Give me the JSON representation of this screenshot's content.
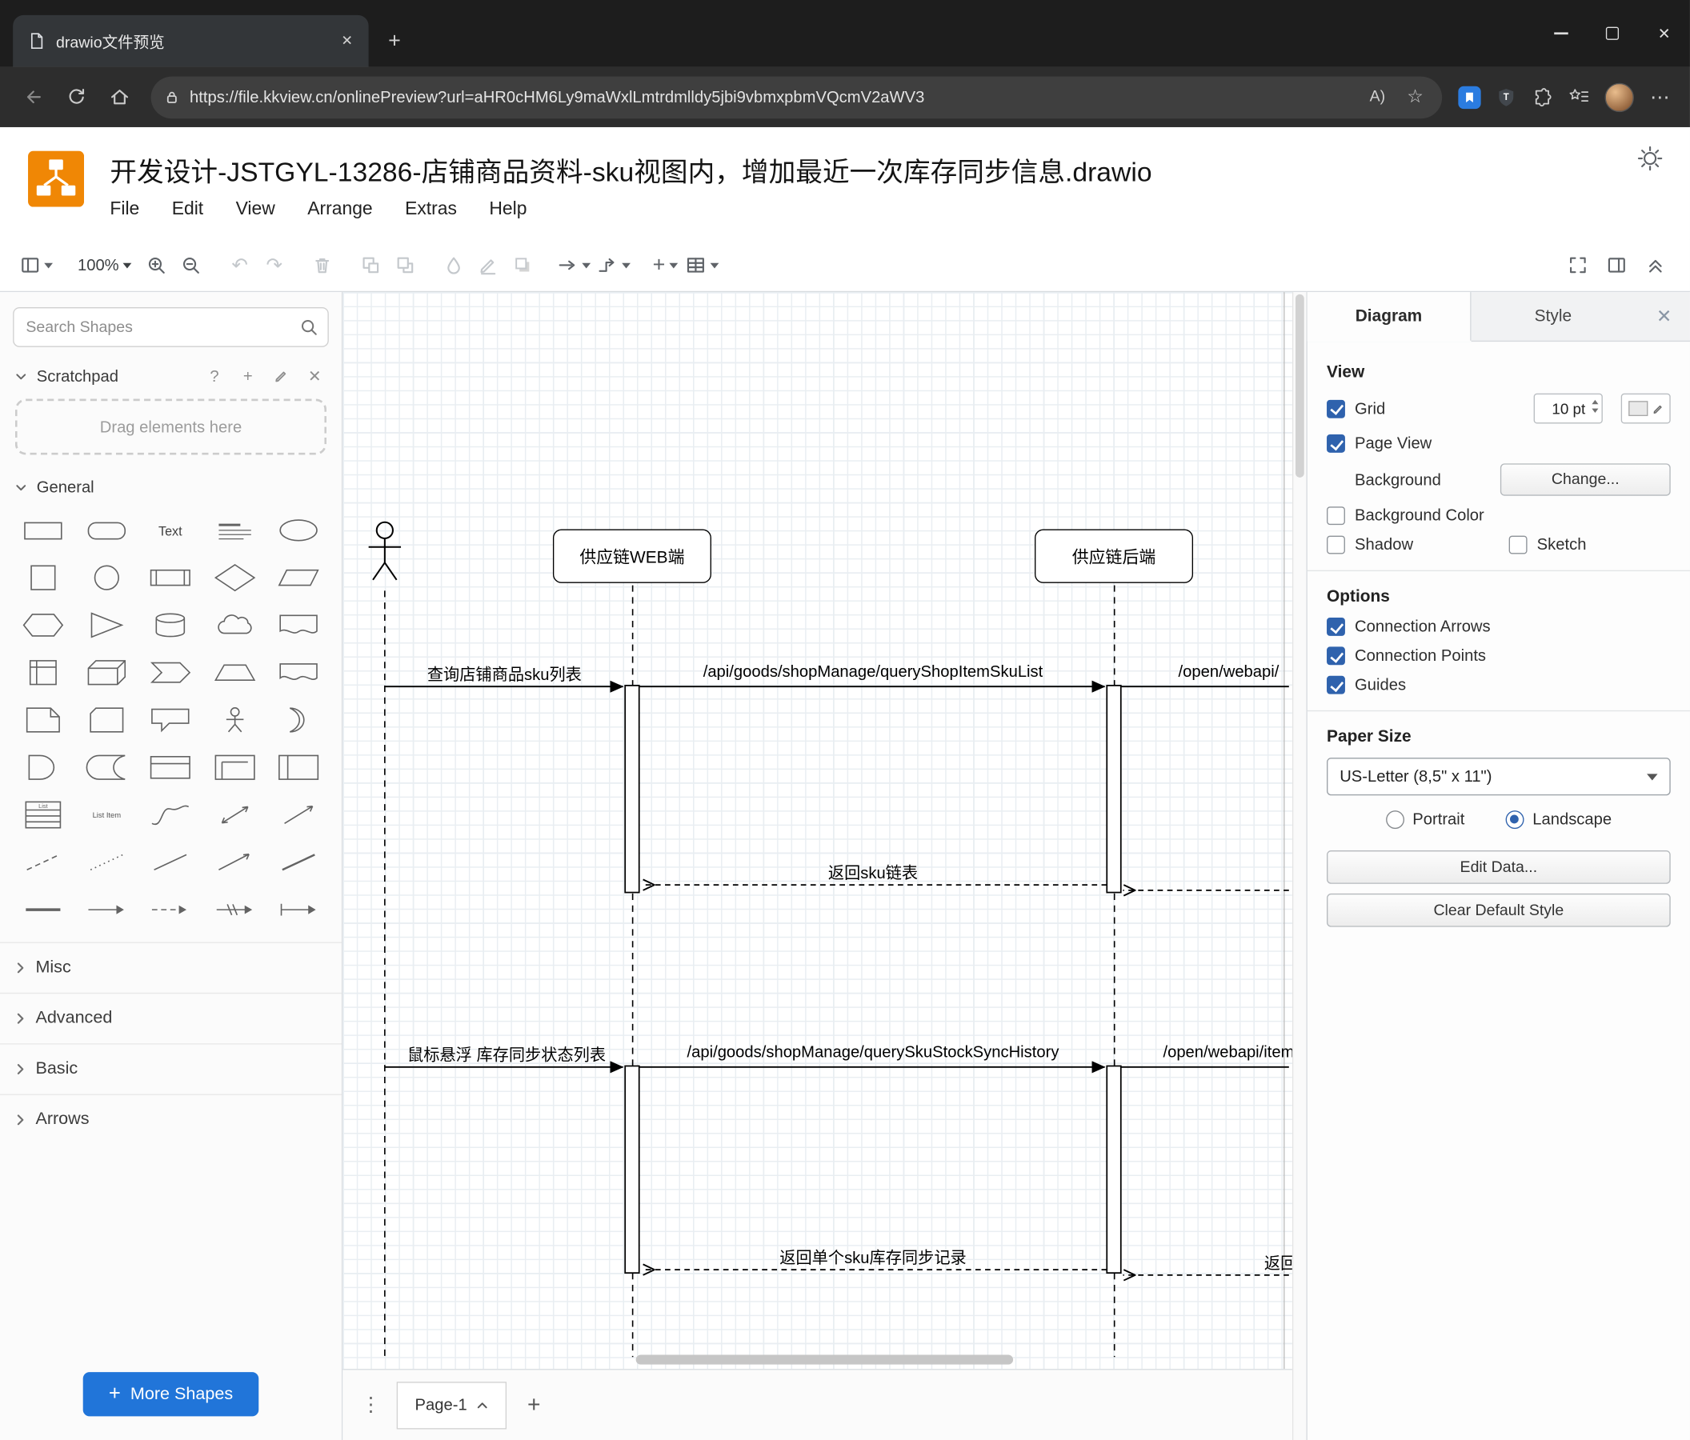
{
  "browser": {
    "tab_title": "drawio文件预览",
    "url": "https://file.kkview.cn/onlinePreview?url=aHR0cHM6Ly9maWxlLmtrdmlldy5jbi9vbmxpbmVQcmV2aWV3",
    "glyphs": {
      "close": "✕",
      "new_tab": "+",
      "read_aloud": "A)",
      "favorite": "☆",
      "more": "⋯"
    }
  },
  "header": {
    "title": "开发设计-JSTGYL-13286-店铺商品资料-sku视图内，增加最近一次库存同步信息.drawio",
    "menus": [
      "File",
      "Edit",
      "View",
      "Arrange",
      "Extras",
      "Help"
    ]
  },
  "toolbar": {
    "zoom": "100%",
    "insert_glyph": "+"
  },
  "sidebar": {
    "search_placeholder": "Search Shapes",
    "scratchpad_title": "Scratchpad",
    "drag_hint": "Drag elements here",
    "glyphs": {
      "help": "?",
      "add": "+",
      "close": "✕"
    },
    "sections": {
      "general": "General",
      "misc": "Misc",
      "advanced": "Advanced",
      "basic": "Basic",
      "arrows": "Arrows"
    },
    "shape_text_preview": "Text",
    "shape_list_label": "List",
    "shape_list_item_label": "List Item",
    "more_shapes": "More Shapes",
    "shape_names": [
      "rectangle",
      "rounded-rectangle",
      "text",
      "heading",
      "ellipse",
      "square",
      "circle",
      "process",
      "diamond",
      "parallelogram",
      "hexagon",
      "triangle",
      "cylinder",
      "cloud",
      "document",
      "internal-storage",
      "cube",
      "step",
      "trapezoid",
      "tape",
      "note",
      "card",
      "callout",
      "actor",
      "or",
      "and",
      "data-storage",
      "container",
      "frame",
      "vertical-container",
      "list",
      "list-item",
      "curve",
      "bidirectional-arrow",
      "diagonal-arrow",
      "dashed-line",
      "dotted-line",
      "line",
      "directional-arrow",
      "diagonal-line",
      "horizontal-line",
      "arrow",
      "dashed-arrow",
      "link",
      "arrow-with-tail"
    ]
  },
  "canvas": {
    "lifelines": {
      "web": "供应链WEB端",
      "backend": "供应链后端"
    },
    "messages": {
      "query_sku_list": "查询店铺商品sku列表",
      "api_query_shop_item_sku_list": "/api/goods/shopManage/queryShopItemSkuList",
      "open_webapi_right": "/open/webapi/",
      "return_sku_list": "返回sku链表",
      "hover_stock_sync_list": "鼠标悬浮 库存同步状态列表",
      "api_query_sku_stock_sync_history": "/api/goods/shopManage/querySkuStockSyncHistory",
      "open_webapi_item": "/open/webapi/item",
      "return_single_sku_record": "返回单个sku库存同步记录",
      "return_partial": "返回"
    }
  },
  "footer": {
    "page_tab": "Page-1",
    "kebab": "⋮",
    "add_page": "+"
  },
  "panel": {
    "tabs": {
      "diagram": "Diagram",
      "style": "Style",
      "close": "✕"
    },
    "view": {
      "heading": "View",
      "grid_label": "Grid",
      "grid_checked": true,
      "grid_value": "10 pt",
      "page_view_label": "Page View",
      "page_view_checked": true,
      "background_label": "Background",
      "change_button": "Change...",
      "background_color_label": "Background Color",
      "background_color_checked": false,
      "shadow_label": "Shadow",
      "shadow_checked": false,
      "sketch_label": "Sketch",
      "sketch_checked": false
    },
    "options": {
      "heading": "Options",
      "connection_arrows": "Connection Arrows",
      "connection_arrows_checked": true,
      "connection_points": "Connection Points",
      "connection_points_checked": true,
      "guides": "Guides",
      "guides_checked": true
    },
    "paper": {
      "heading": "Paper Size",
      "size_value": "US-Letter (8,5\" x 11\")",
      "portrait": "Portrait",
      "landscape": "Landscape",
      "orientation": "Landscape"
    },
    "edit_data_button": "Edit Data...",
    "clear_default_style_button": "Clear Default Style"
  },
  "colors": {
    "accent_blue": "#2175d9",
    "logo_orange": "#f08705",
    "check_blue": "#2f62ad"
  }
}
